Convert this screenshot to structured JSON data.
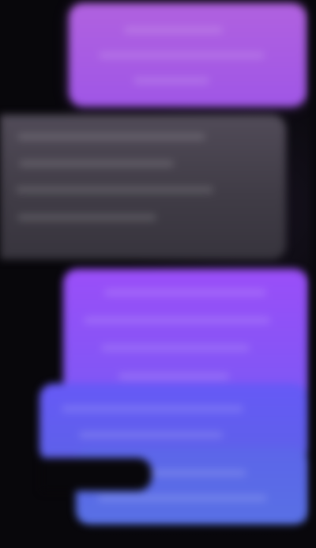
{
  "conversation": {
    "messages": [
      {
        "type": "outgoing",
        "style": "purple",
        "text": ""
      },
      {
        "type": "incoming",
        "style": "gray",
        "text": ""
      },
      {
        "type": "outgoing",
        "style": "violet",
        "text": ""
      },
      {
        "type": "outgoing",
        "style": "blue",
        "text": ""
      },
      {
        "type": "outgoing",
        "style": "blue",
        "text": ""
      }
    ]
  },
  "colors": {
    "background": "#08070b",
    "outgoing_purple": "#a95ae2",
    "incoming_gray": "#48434f",
    "outgoing_violet": "#8b54f6",
    "outgoing_blue": "#5d66e9"
  }
}
